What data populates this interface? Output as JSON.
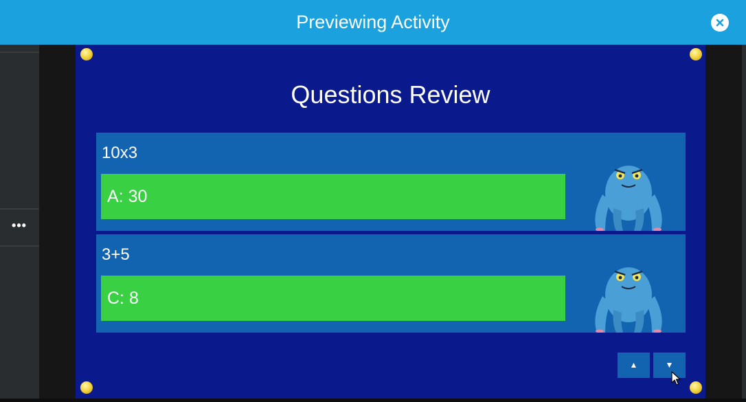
{
  "window": {
    "title": "Previewing Activity",
    "close_icon": "close-icon"
  },
  "sidebar": {
    "more_label": "•••"
  },
  "activity": {
    "title": "Questions Review",
    "questions": [
      {
        "question": "10x3",
        "answer": "A: 30"
      },
      {
        "question": "3+5",
        "answer": "C: 8"
      }
    ],
    "nav": {
      "up_icon": "▲",
      "down_icon": "▼"
    }
  },
  "colors": {
    "header": "#1ba2de",
    "stage": "#0a1a8c",
    "card": "#1364b0",
    "correct_answer": "#39d143",
    "stud": "#f5d743"
  }
}
